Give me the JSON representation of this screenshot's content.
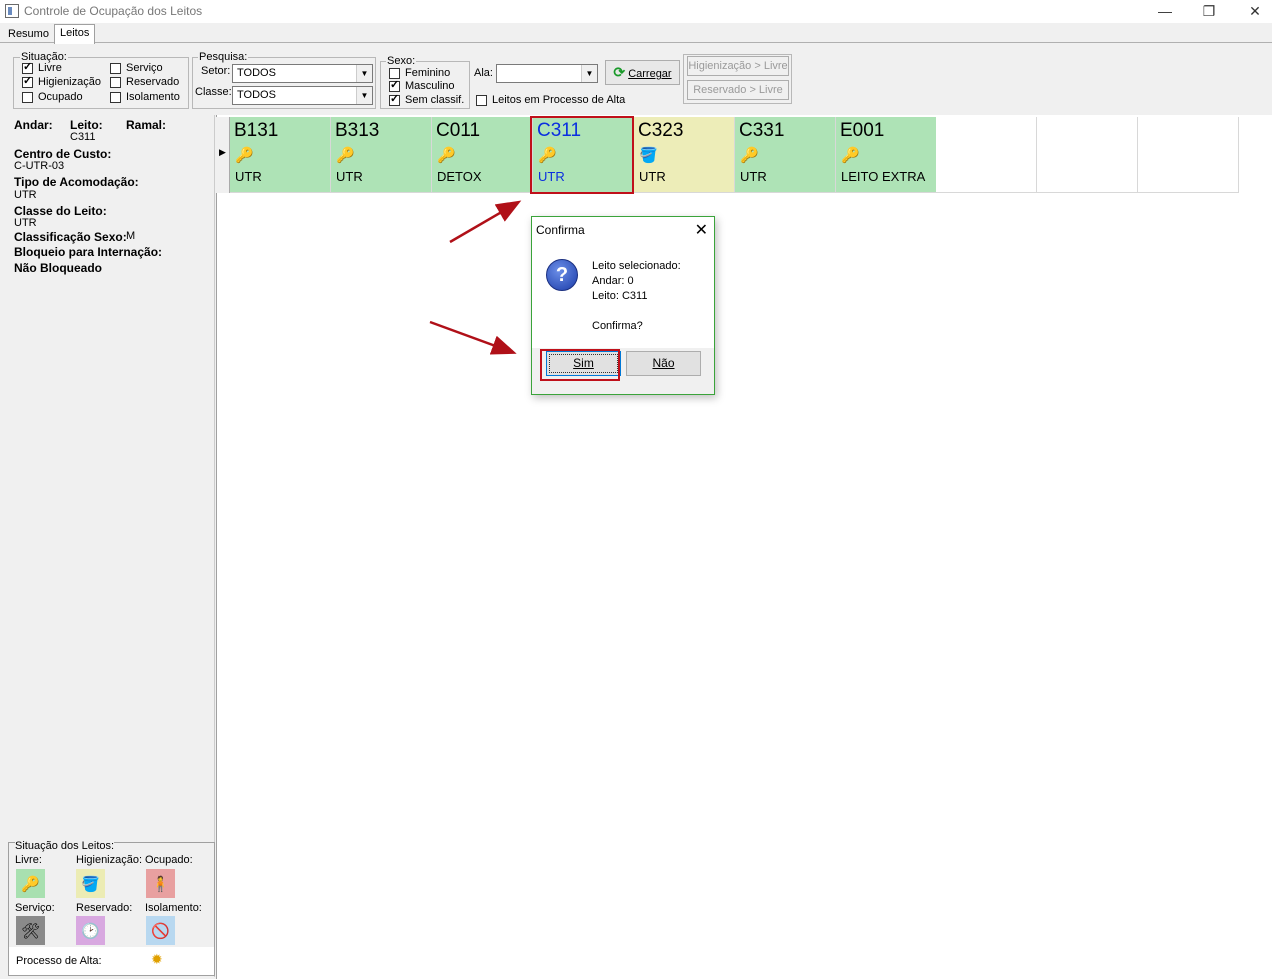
{
  "window": {
    "title": "Controle de Ocupação dos Leitos",
    "minimize": "—",
    "restore": "❐",
    "close": "✕"
  },
  "tabs": [
    {
      "label": "Resumo"
    },
    {
      "label": "Leitos"
    }
  ],
  "situacao": {
    "label": "Situação:",
    "items": [
      {
        "label": "Livre",
        "checked": true
      },
      {
        "label": "Higienização",
        "checked": true
      },
      {
        "label": "Ocupado",
        "checked": false
      },
      {
        "label": "Serviço",
        "checked": false
      },
      {
        "label": "Reservado",
        "checked": false
      },
      {
        "label": "Isolamento",
        "checked": false
      }
    ]
  },
  "pesquisa": {
    "label": "Pesquisa:",
    "setor_label": "Setor:",
    "setor_value": "TODOS",
    "classe_label": "Classe:",
    "classe_value": "TODOS"
  },
  "sexo": {
    "label": "Sexo:",
    "items": [
      {
        "label": "Feminino",
        "checked": false
      },
      {
        "label": "Masculino",
        "checked": true
      },
      {
        "label": "Sem classif.",
        "checked": true
      }
    ]
  },
  "ala": {
    "label": "Ala:",
    "value": ""
  },
  "leitos_alta": {
    "label": "Leitos em Processo de Alta",
    "checked": false
  },
  "buttons": {
    "carregar": "Carregar",
    "higienizacao_livre": "Higienização > Livre",
    "reservado_livre": "Reservado > Livre"
  },
  "info": {
    "andar_label": "Andar:",
    "leito_label": "Leito:",
    "leito_value": "C311",
    "ramal_label": "Ramal:",
    "centro_label": "Centro de Custo:",
    "centro_value": "C-UTR-03",
    "tipo_label": "Tipo de Acomodação:",
    "tipo_value": "UTR",
    "classe_label": "Classe do Leito:",
    "classe_value": "UTR",
    "sexo_label": "Classificação Sexo:",
    "sexo_value": "M",
    "bloqueio_label": "Bloqueio para Internação:",
    "bloqueio_value": "Não Bloqueado"
  },
  "legend": {
    "title": "Situação dos Leitos:",
    "livre": "Livre:",
    "higienizacao": "Higienização:",
    "ocupado": "Ocupado:",
    "servico": "Serviço:",
    "reservado": "Reservado:",
    "isolamento": "Isolamento:",
    "processo_alta": "Processo de Alta:",
    "colors": {
      "livre": "#a8e0b0",
      "higienizacao": "#ececb4",
      "ocupado": "#e8a0a0",
      "servico": "#8a8a8a",
      "reservado": "#d8a8e0",
      "isolamento": "#b8d8f0"
    }
  },
  "beds": [
    {
      "code": "B131",
      "class": "UTR",
      "status": "livre",
      "icon": "key-person-icon"
    },
    {
      "code": "B313",
      "class": "UTR",
      "status": "livre",
      "icon": "key-person-icon"
    },
    {
      "code": "C011",
      "class": "DETOX",
      "status": "livre",
      "icon": "key-person-icon"
    },
    {
      "code": "C311",
      "class": "UTR",
      "status": "livre",
      "icon": "key-person-icon",
      "selected": true
    },
    {
      "code": "C323",
      "class": "UTR",
      "status": "higienizacao",
      "icon": "bucket-icon"
    },
    {
      "code": "C331",
      "class": "UTR",
      "status": "livre",
      "icon": "key-person-icon"
    },
    {
      "code": "E001",
      "class": "LEITO EXTRA",
      "status": "livre",
      "icon": "key-person-icon"
    }
  ],
  "bed_colors": {
    "livre": "#aee3b6",
    "higienizacao": "#ededb8"
  },
  "dialog": {
    "title": "Confirma",
    "close": "✕",
    "line1": "Leito selecionado:",
    "line2": "Andar: 0",
    "line3": "Leito: C311",
    "line4": "Confirma?",
    "sim": "Sim",
    "nao": "Não"
  }
}
